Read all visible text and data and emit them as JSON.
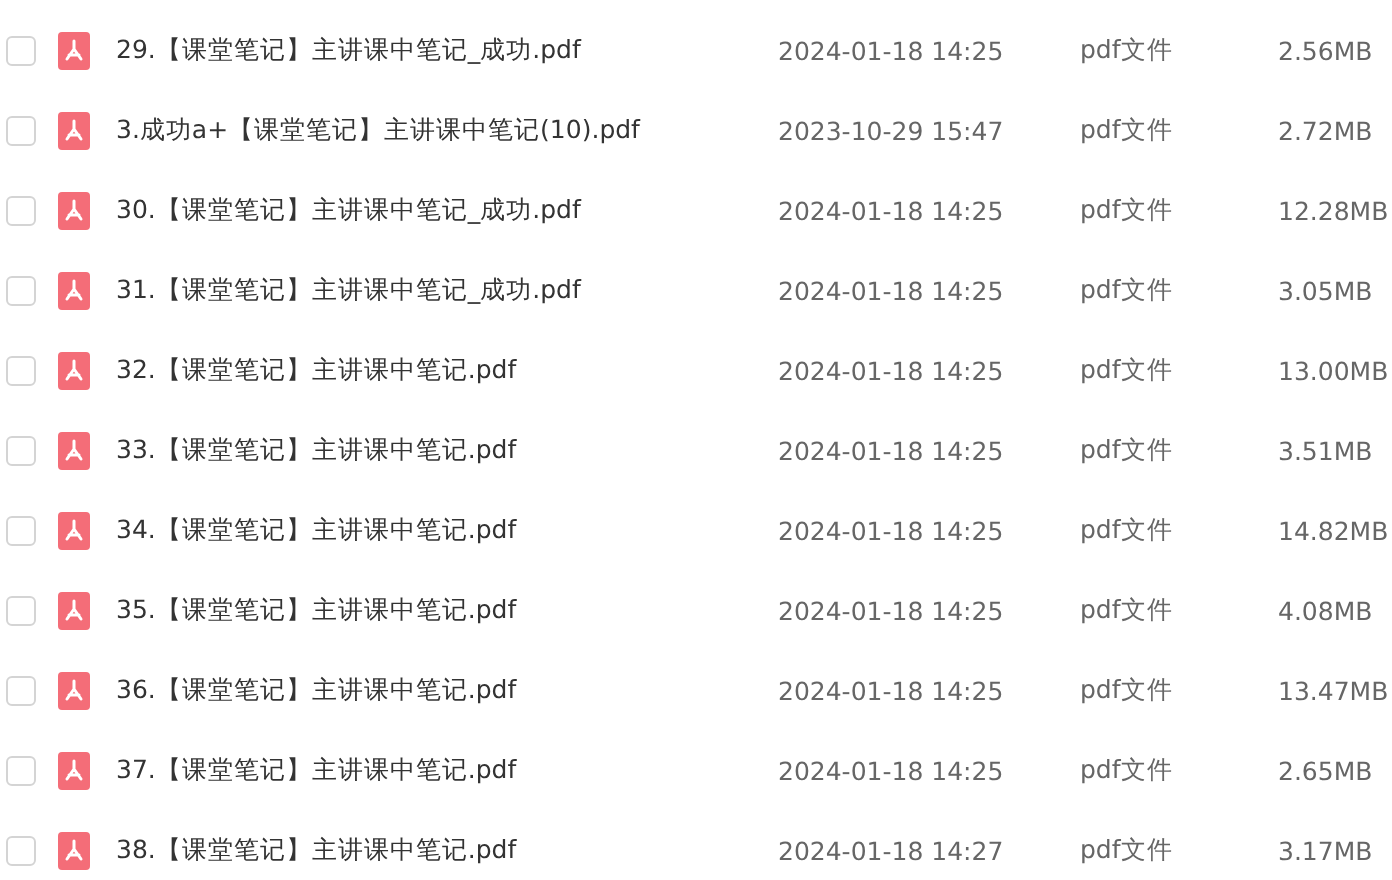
{
  "files": [
    {
      "name": "29.【课堂笔记】主讲课中笔记_成功.pdf",
      "modified": "2024-01-18 14:25",
      "type": "pdf文件",
      "size": "2.56MB",
      "selected": false
    },
    {
      "name": "3.成功a+【课堂笔记】主讲课中笔记(10).pdf",
      "modified": "2023-10-29 15:47",
      "type": "pdf文件",
      "size": "2.72MB",
      "selected": false
    },
    {
      "name": "30.【课堂笔记】主讲课中笔记_成功.pdf",
      "modified": "2024-01-18 14:25",
      "type": "pdf文件",
      "size": "12.28MB",
      "selected": false
    },
    {
      "name": "31.【课堂笔记】主讲课中笔记_成功.pdf",
      "modified": "2024-01-18 14:25",
      "type": "pdf文件",
      "size": "3.05MB",
      "selected": false
    },
    {
      "name": "32.【课堂笔记】主讲课中笔记.pdf",
      "modified": "2024-01-18 14:25",
      "type": "pdf文件",
      "size": "13.00MB",
      "selected": false
    },
    {
      "name": "33.【课堂笔记】主讲课中笔记.pdf",
      "modified": "2024-01-18 14:25",
      "type": "pdf文件",
      "size": "3.51MB",
      "selected": false
    },
    {
      "name": "34.【课堂笔记】主讲课中笔记.pdf",
      "modified": "2024-01-18 14:25",
      "type": "pdf文件",
      "size": "14.82MB",
      "selected": false
    },
    {
      "name": "35.【课堂笔记】主讲课中笔记.pdf",
      "modified": "2024-01-18 14:25",
      "type": "pdf文件",
      "size": "4.08MB",
      "selected": false
    },
    {
      "name": "36.【课堂笔记】主讲课中笔记.pdf",
      "modified": "2024-01-18 14:25",
      "type": "pdf文件",
      "size": "13.47MB",
      "selected": false
    },
    {
      "name": "37.【课堂笔记】主讲课中笔记.pdf",
      "modified": "2024-01-18 14:25",
      "type": "pdf文件",
      "size": "2.65MB",
      "selected": false
    },
    {
      "name": "38.【课堂笔记】主讲课中笔记.pdf",
      "modified": "2024-01-18 14:27",
      "type": "pdf文件",
      "size": "3.17MB",
      "selected": false
    }
  ]
}
